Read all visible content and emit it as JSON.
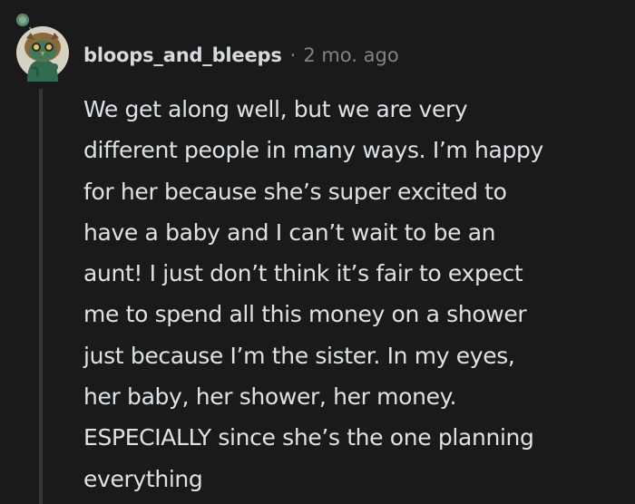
{
  "comment": {
    "username": "bloops_and_bleeps",
    "separator": "·",
    "timestamp": "2 mo. ago",
    "body_lines": [
      "We get along well, but we are very",
      "different people in many ways. I’m happy",
      "for her because she’s super excited to",
      "have a baby and I can’t wait to be an",
      "aunt! I just don’t think it’s fair to expect",
      "me to spend all this money on a shower",
      "just because I’m the sister. In my eyes,",
      "her baby, her shower, her money.",
      "ESPECIALLY since she’s the one planning",
      "everything"
    ]
  },
  "avatar": {
    "icon": "snoo-owl-avatar-icon",
    "background_color": "#d7d1c2",
    "body_color": "#2f6b4f",
    "head_color": "#8a6a3a"
  },
  "colors": {
    "background": "#1a1a1b",
    "text": "#e0e1e2",
    "muted": "#818384",
    "thread_line": "#343536"
  }
}
